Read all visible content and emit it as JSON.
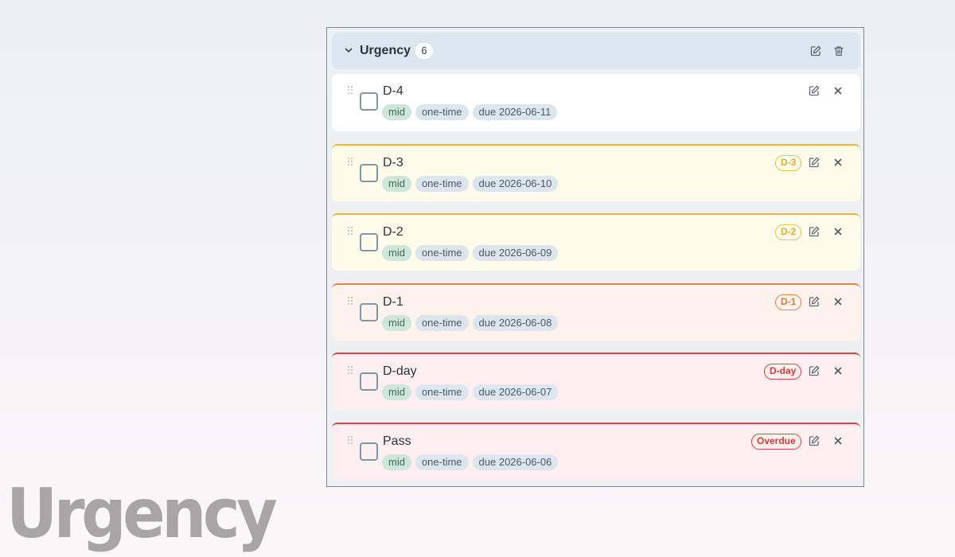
{
  "watermark": "Urgency",
  "group": {
    "title": "Urgency",
    "count": "6",
    "edit_icon": "edit-icon",
    "delete_icon": "trash-icon",
    "chevron_icon": "chevron-down-icon"
  },
  "tasks": [
    {
      "title": "D-4",
      "priority": "mid",
      "recurrence": "one-time",
      "due": "due 2026-06-11",
      "badge": "",
      "accent": "none"
    },
    {
      "title": "D-3",
      "priority": "mid",
      "recurrence": "one-time",
      "due": "due 2026-06-10",
      "badge": "D-3",
      "accent": "yellow"
    },
    {
      "title": "D-2",
      "priority": "mid",
      "recurrence": "one-time",
      "due": "due 2026-06-09",
      "badge": "D-2",
      "accent": "yellow"
    },
    {
      "title": "D-1",
      "priority": "mid",
      "recurrence": "one-time",
      "due": "due 2026-06-08",
      "badge": "D-1",
      "accent": "orange"
    },
    {
      "title": "D-day",
      "priority": "mid",
      "recurrence": "one-time",
      "due": "due 2026-06-07",
      "badge": "D-day",
      "accent": "red"
    },
    {
      "title": "Pass",
      "priority": "mid",
      "recurrence": "one-time",
      "due": "due 2026-06-06",
      "badge": "Overdue",
      "accent": "red"
    }
  ],
  "colors": {
    "yellow": "#f0b73a",
    "orange": "#e8834a",
    "red": "#dd4646",
    "header_bg": "#dbe6ee",
    "priority_tag_bg": "#cfe7da"
  }
}
